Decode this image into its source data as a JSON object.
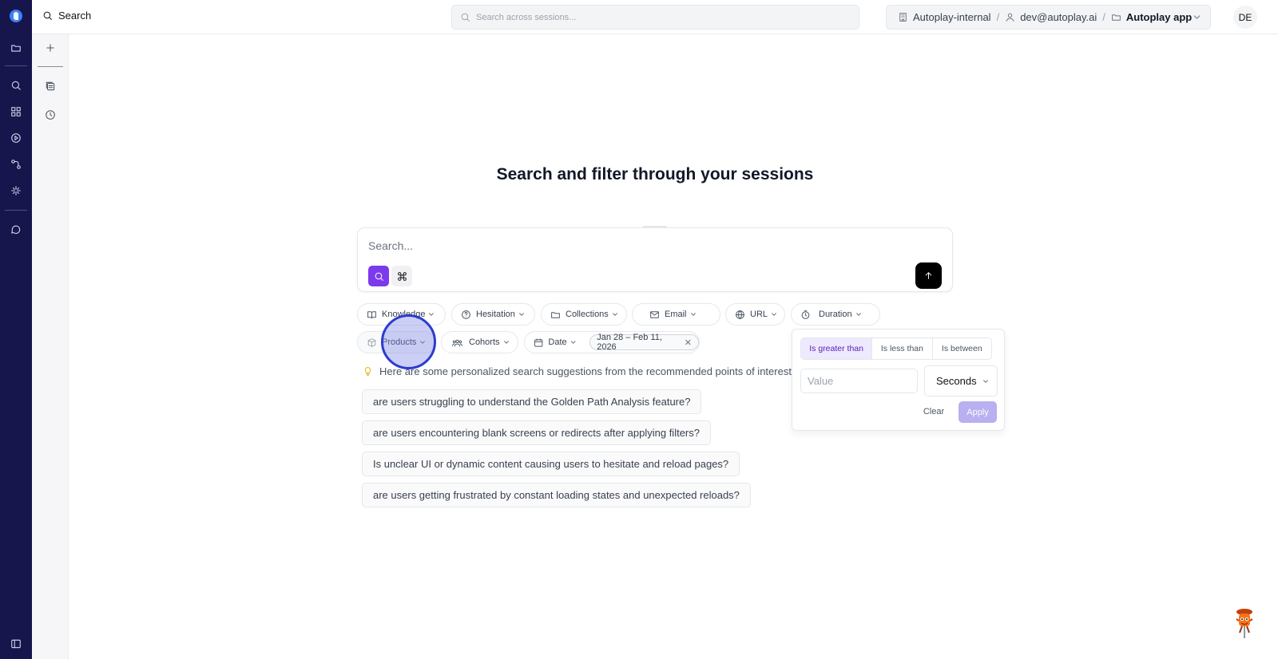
{
  "header": {
    "title": "Search",
    "global_search_placeholder": "Search across sessions...",
    "breadcrumb": {
      "org": "Autoplay-internal",
      "user": "dev@autoplay.ai",
      "app": "Autoplay app"
    },
    "avatar_initials": "DE"
  },
  "main": {
    "title": "Search and filter through your sessions",
    "search_placeholder": "Search...",
    "filters_row1": [
      "Knowledge",
      "Hesitation",
      "Collections",
      "Email",
      "URL",
      "Duration"
    ],
    "filters_row2": [
      "Products",
      "Cohorts",
      "Date"
    ],
    "date_range": "Jan 28 – Feb 11, 2026",
    "suggestions_heading": "Here are some personalized search suggestions from the recommended points of interest we",
    "suggestions": [
      "are users struggling to understand the Golden Path Analysis feature?",
      "are users encountering blank screens or redirects after applying filters?",
      "Is unclear UI or dynamic content causing users to hesitate and reload pages?",
      "are users getting frustrated by constant loading states and unexpected reloads?"
    ]
  },
  "duration_popover": {
    "operators": [
      "Is greater than",
      "Is less than",
      "Is between"
    ],
    "selected_operator": "Is greater than",
    "value_placeholder": "Value",
    "unit": "Seconds",
    "clear_label": "Clear",
    "apply_label": "Apply"
  },
  "colors": {
    "rail": "#16164d",
    "accent": "#7c3aed",
    "highlight": "#2d3ccf"
  }
}
